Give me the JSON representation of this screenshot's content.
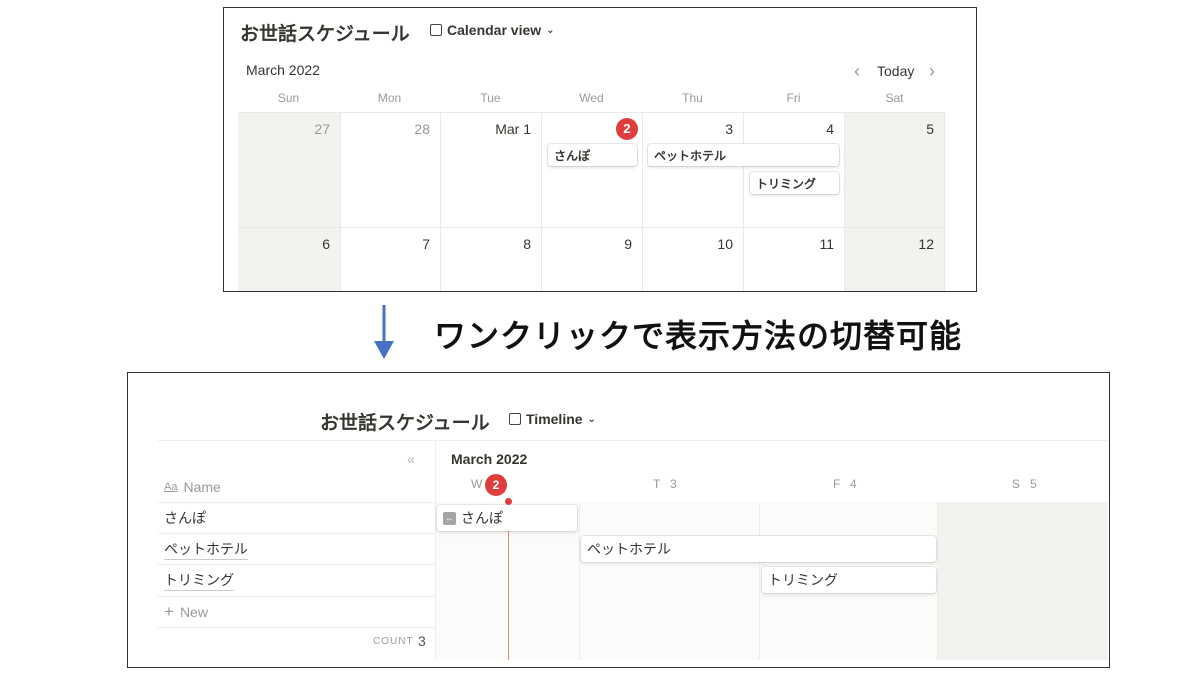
{
  "calendar": {
    "title": "お世話スケジュール",
    "view_label": "Calendar view",
    "month": "March 2022",
    "today_label": "Today",
    "weekdays": [
      "Sun",
      "Mon",
      "Tue",
      "Wed",
      "Thu",
      "Fri",
      "Sat"
    ],
    "week1": [
      "27",
      "28",
      "Mar 1",
      "2",
      "3",
      "4",
      "5"
    ],
    "week2": [
      "6",
      "7",
      "8",
      "9",
      "10",
      "11",
      "12"
    ],
    "events": [
      "さんぽ",
      "ペットホテル",
      "トリミング"
    ]
  },
  "caption": "ワンクリックで表示方法の切替可能",
  "timeline": {
    "title": "お世話スケジュール",
    "view_label": "Timeline",
    "month": "March 2022",
    "name_header": "Name",
    "name_icon_text": "Aa",
    "rows": [
      "さんぽ",
      "ペットホテル",
      "トリミング"
    ],
    "new_label": "New",
    "count_label": "COUNT",
    "count_value": "3",
    "days": [
      {
        "letter": "W",
        "num": "2"
      },
      {
        "letter": "T",
        "num": "3"
      },
      {
        "letter": "F",
        "num": "4"
      },
      {
        "letter": "S",
        "num": "5"
      }
    ]
  },
  "colors": {
    "today": "#e03e3e",
    "arrow": "#4472c4"
  }
}
